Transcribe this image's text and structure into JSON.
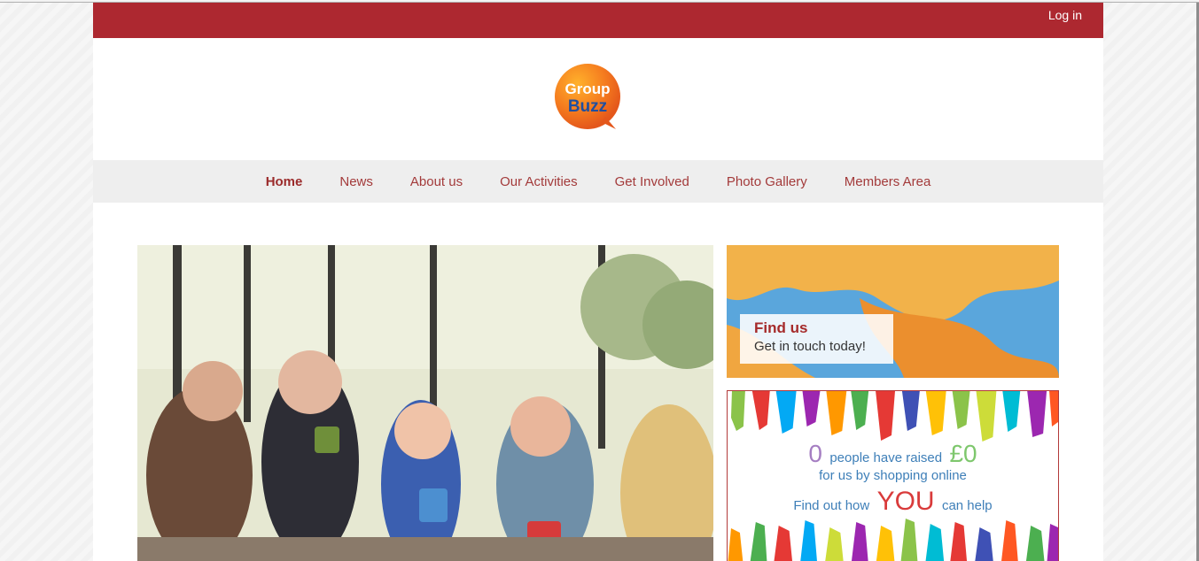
{
  "topbar": {
    "login_label": "Log in"
  },
  "logo": {
    "line1": "Group",
    "line2": "Buzz"
  },
  "nav": {
    "items": [
      {
        "label": "Home",
        "active": true
      },
      {
        "label": "News"
      },
      {
        "label": "About us"
      },
      {
        "label": "Our Activities"
      },
      {
        "label": "Get Involved"
      },
      {
        "label": "Photo Gallery"
      },
      {
        "label": "Members Area"
      }
    ]
  },
  "findus": {
    "title": "Find us",
    "subtitle": "Get in touch today!"
  },
  "raised": {
    "count": "0",
    "text1": "people have raised",
    "amount": "£0",
    "text2": "for us by shopping online",
    "text3": "Find out how",
    "you": "YOU",
    "text4": "can help"
  },
  "colors": {
    "brand_red": "#ad2830",
    "nav_bg": "#eeeeee"
  }
}
